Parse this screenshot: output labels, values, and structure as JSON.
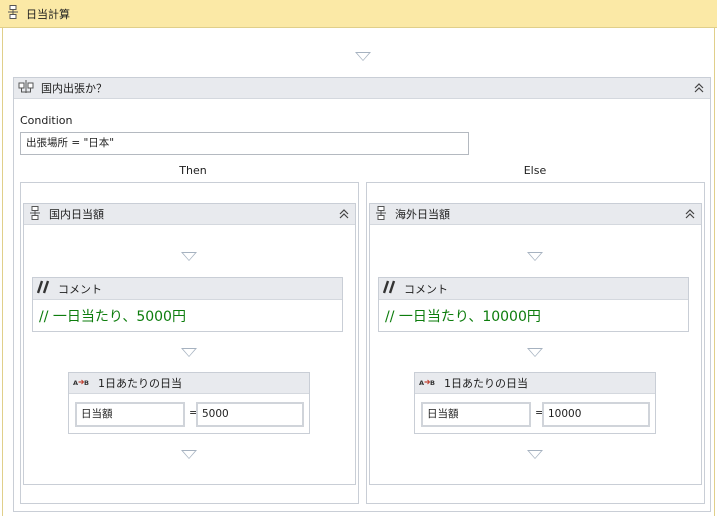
{
  "sequence": {
    "title": "日当計算"
  },
  "if": {
    "title": "国内出張か？",
    "condition_label": "Condition",
    "condition_value": "出張場所 = \"日本\"",
    "then_label": "Then",
    "else_label": "Else"
  },
  "then_branch": {
    "title": "国内日当額",
    "comment": {
      "title": "コメント",
      "text": "// 一日当たり、5000円"
    },
    "assign": {
      "title": "1日あたりの日当",
      "to": "日当額",
      "value": "5000"
    }
  },
  "else_branch": {
    "title": "海外日当額",
    "comment": {
      "title": "コメント",
      "text": "// 一日当たり、10000円"
    },
    "assign": {
      "title": "1日あたりの日当",
      "to": "日当額",
      "value": "10000"
    }
  },
  "icons": {
    "sequence": "sequence-icon",
    "if": "flow-decision-icon",
    "comment": "comment-icon",
    "assign": "assign-icon",
    "collapse": "collapse-icon"
  },
  "colors": {
    "sequence_header": "#fbe9a6",
    "activity_header": "#e8eaee",
    "comment_text": "#0d7d0d",
    "drop_arrow": "#a6b2c0"
  }
}
